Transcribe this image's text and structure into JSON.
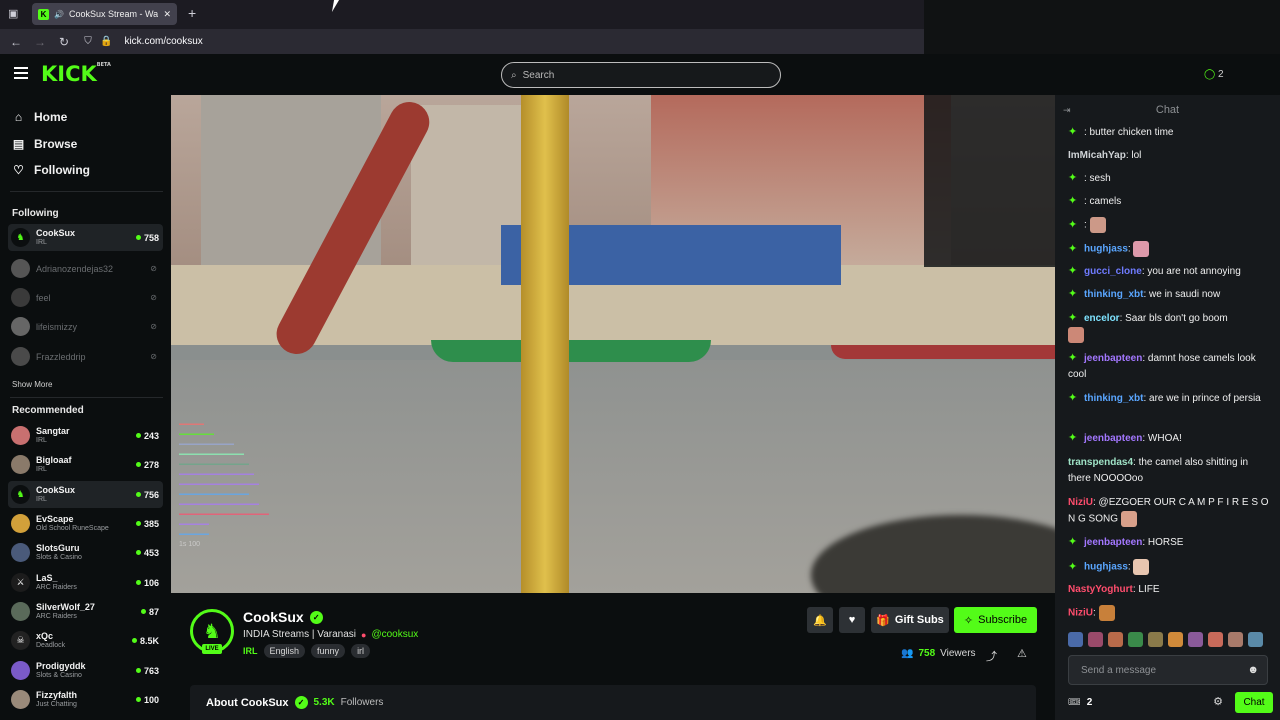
{
  "browser": {
    "tab_title": "CookSux Stream - Watch Li",
    "url": "kick.com/cooksux"
  },
  "header": {
    "logo": "KICK",
    "logo_badge": "BETA",
    "search_placeholder": "Search"
  },
  "sidebar": {
    "nav": [
      {
        "label": "Home",
        "icon": "home-icon"
      },
      {
        "label": "Browse",
        "icon": "browse-icon"
      },
      {
        "label": "Following",
        "icon": "heart-icon"
      }
    ],
    "following_label": "Following",
    "following": [
      {
        "name": "CookSux",
        "category": "IRL",
        "viewers": "758",
        "live": true,
        "active": true
      },
      {
        "name": "Adrianozendejas32",
        "category": "",
        "viewers": "",
        "live": false
      },
      {
        "name": "feel",
        "category": "",
        "viewers": "",
        "live": false
      },
      {
        "name": "lifeismizzy",
        "category": "",
        "viewers": "",
        "live": false
      },
      {
        "name": "Frazzleddrip",
        "category": "",
        "viewers": "",
        "live": false
      }
    ],
    "show_more": "Show More",
    "recommended_label": "Recommended",
    "recommended": [
      {
        "name": "Sangtar",
        "category": "IRL",
        "viewers": "243"
      },
      {
        "name": "Bigloaaf",
        "category": "IRL",
        "viewers": "278"
      },
      {
        "name": "CookSux",
        "category": "IRL",
        "viewers": "756",
        "active": true
      },
      {
        "name": "EvScape",
        "category": "Old School RuneScape",
        "viewers": "385"
      },
      {
        "name": "SlotsGuru",
        "category": "Slots & Casino",
        "viewers": "453"
      },
      {
        "name": "LaS_",
        "category": "ARC Raiders",
        "viewers": "106"
      },
      {
        "name": "SilverWolf_27",
        "category": "ARC Raiders",
        "viewers": "87"
      },
      {
        "name": "xQc",
        "category": "Deadlock",
        "viewers": "8.5K"
      },
      {
        "name": "Prodigyddk",
        "category": "Slots & Casino",
        "viewers": "763"
      },
      {
        "name": "Fizzyfalth",
        "category": "Just Chatting",
        "viewers": "100"
      }
    ]
  },
  "video": {
    "overlay_count": "1s 100"
  },
  "stream": {
    "streamer": "CookSux",
    "live_badge": "LIVE",
    "title": "INDIA Streams | Varanasi",
    "handle": "@cooksux",
    "category": "IRL",
    "tags": [
      "English",
      "funny",
      "irl"
    ],
    "gift_label": "Gift Subs",
    "subscribe_label": "Subscribe",
    "viewers": "758",
    "viewers_label": "Viewers",
    "about_label": "About CookSux",
    "followers": "5.3K",
    "followers_label": "Followers"
  },
  "chat": {
    "title": "Chat",
    "messages": [
      {
        "user": "",
        "text": ": butter chicken time",
        "color": "#53fc18",
        "badge": true
      },
      {
        "user": "ImMicahYap",
        "text": ": lol",
        "color": "#cfd3d6",
        "badge": false
      },
      {
        "user": "",
        "text": ": sesh",
        "color": "#53fc18",
        "badge": true
      },
      {
        "user": "",
        "text": ": camels",
        "color": "#53fc18",
        "badge": true
      },
      {
        "user": "",
        "text": ":",
        "color": "#e0324b",
        "badge": true
      },
      {
        "user": "hughjass",
        "text": ":",
        "color": "#5aa6ff",
        "badge": true
      },
      {
        "user": "gucci_clone",
        "text": ": you are not annoying",
        "color": "#6f7bff",
        "badge": true
      },
      {
        "user": "thinking_xbt",
        "text": ": we in saudi now",
        "color": "#5aa6ff",
        "badge": true
      },
      {
        "user": "encelor",
        "text": ": Saar bls don't go boom",
        "color": "#7ee3ff",
        "badge": true
      },
      {
        "user": "jeenbapteen",
        "text": ": damnt hose camels look cool",
        "color": "#a377ff",
        "badge": true
      },
      {
        "user": "thinking_xbt",
        "text": ": are we in prince of persia",
        "color": "#5aa6ff",
        "badge": true
      },
      {
        "user": "jeenbapteen",
        "text": ": WHOA!",
        "color": "#a377ff",
        "badge": true
      },
      {
        "user": "transpendas4",
        "text": ": the camel also shitting in there NOOOOoo",
        "color": "#9fe2c6",
        "badge": false
      },
      {
        "user": "NiziU",
        "text": ": @EZGOER OUR C A M P F I R E S O N G SONG",
        "color": "#ff4d6d",
        "badge": false
      },
      {
        "user": "jeenbapteen",
        "text": ": HORSE",
        "color": "#a377ff",
        "badge": true
      },
      {
        "user": "hughjass",
        "text": ":",
        "color": "#5aa6ff",
        "badge": true
      },
      {
        "user": "NastyYoghurt",
        "text": ": LIFE",
        "color": "#ff4d6d",
        "badge": false
      },
      {
        "user": "NiziU",
        "text": ":",
        "color": "#ff4d6d",
        "badge": false
      }
    ],
    "input_placeholder": "Send a message",
    "points": "2",
    "send_label": "Chat",
    "top_count": "2"
  }
}
